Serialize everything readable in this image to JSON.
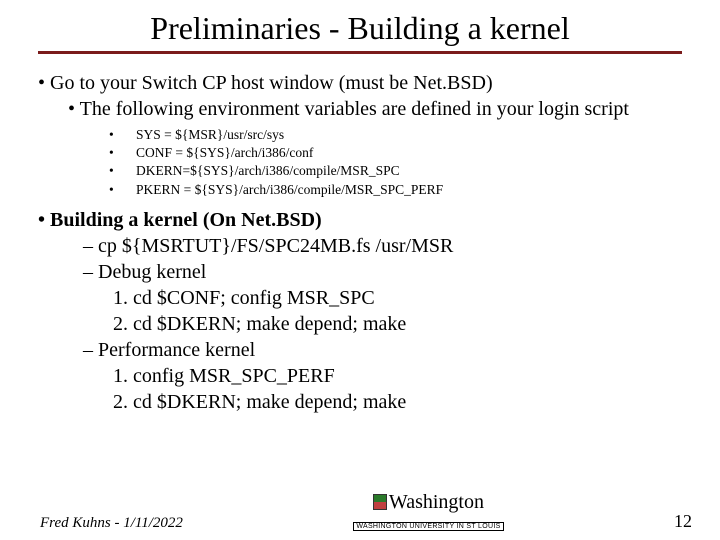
{
  "title": "Preliminaries - Building a kernel",
  "b1_1": "Go to your Switch CP host window (must be Net.BSD)",
  "b2_1": "The following environment variables are defined in your login script",
  "env": {
    "e1": "SYS = ${MSR}/usr/src/sys",
    "e2": "CONF = ${SYS}/arch/i386/conf",
    "e3": "DKERN=${SYS}/arch/i386/compile/MSR_SPC",
    "e4": "PKERN = ${SYS}/arch/i386/compile/MSR_SPC_PERF"
  },
  "b1_2": "Building a kernel (On Net.BSD)",
  "d1": "cp ${MSRTUT}/FS/SPC24MB.fs /usr/MSR",
  "d2": "Debug kernel",
  "n1": "1. cd $CONF; config MSR_SPC",
  "n2": "2. cd $DKERN; make depend; make",
  "d3": "Performance kernel",
  "n3": "1. config MSR_SPC_PERF",
  "n4": "2. cd $DKERN; make depend; make",
  "footer": {
    "left": "Fred Kuhns - 1/11/2022",
    "center": "Washington",
    "sub": "WASHINGTON UNIVERSITY IN ST LOUIS",
    "right": "12"
  }
}
